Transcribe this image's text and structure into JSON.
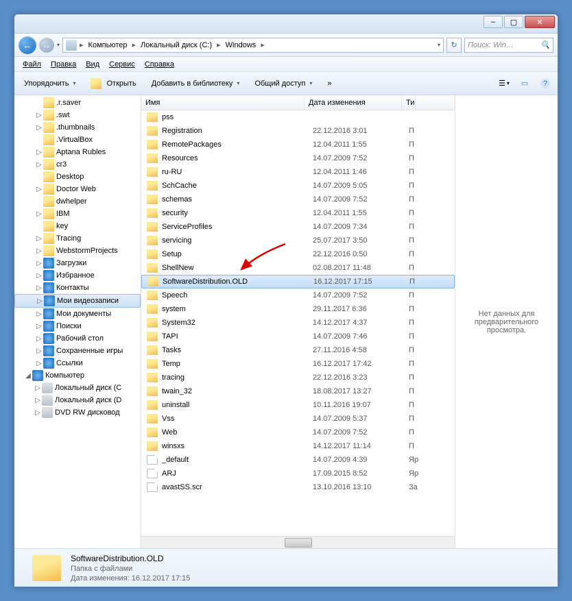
{
  "titlebar": {
    "min": "–",
    "max": "▢",
    "close": "✕"
  },
  "nav": {
    "back_arrow": "←",
    "fwd_arrow": "→",
    "dropdown": "▾",
    "crumbs": [
      "Компьютер",
      "Локальный диск (C:)",
      "Windows"
    ],
    "sep": "▸",
    "refresh_icon": "↻",
    "search_placeholder": "Поиск: Win…",
    "search_icon": "🔍"
  },
  "menu": [
    "Файл",
    "Правка",
    "Вид",
    "Сервис",
    "Справка"
  ],
  "toolbar": {
    "organize": "Упорядочить",
    "open": "Открыть",
    "addlib": "Добавить в библиотеку",
    "share": "Общий доступ",
    "more": "»",
    "view_icon": "☰",
    "preview_icon": "▭",
    "help_icon": "?"
  },
  "tree": [
    {
      "ind": 30,
      "exp": "",
      "icon": "f",
      "label": ".r.saver"
    },
    {
      "ind": 30,
      "exp": "▷",
      "icon": "f",
      "label": ".swt"
    },
    {
      "ind": 30,
      "exp": "▷",
      "icon": "f",
      "label": ".thumbnails"
    },
    {
      "ind": 30,
      "exp": "",
      "icon": "f",
      "label": ".VirtualBox"
    },
    {
      "ind": 30,
      "exp": "▷",
      "icon": "f",
      "label": "Aptana Rubles"
    },
    {
      "ind": 30,
      "exp": "▷",
      "icon": "f",
      "label": "cr3"
    },
    {
      "ind": 30,
      "exp": "",
      "icon": "f",
      "label": "Desktop"
    },
    {
      "ind": 30,
      "exp": "▷",
      "icon": "f",
      "label": "Doctor Web"
    },
    {
      "ind": 30,
      "exp": "",
      "icon": "f",
      "label": "dwhelper"
    },
    {
      "ind": 30,
      "exp": "▷",
      "icon": "f",
      "label": "IBM"
    },
    {
      "ind": 30,
      "exp": "",
      "icon": "f",
      "label": "key"
    },
    {
      "ind": 30,
      "exp": "▷",
      "icon": "f",
      "label": "Tracing"
    },
    {
      "ind": 30,
      "exp": "▷",
      "icon": "f",
      "label": "WebstormProjects"
    },
    {
      "ind": 30,
      "exp": "▷",
      "icon": "sp",
      "label": "Загрузки"
    },
    {
      "ind": 30,
      "exp": "▷",
      "icon": "sp",
      "label": "Избранное"
    },
    {
      "ind": 30,
      "exp": "▷",
      "icon": "sp",
      "label": "Контакты"
    },
    {
      "ind": 30,
      "exp": "▷",
      "icon": "sp",
      "label": "Мои видеозаписи",
      "sel": true
    },
    {
      "ind": 30,
      "exp": "▷",
      "icon": "sp",
      "label": "Мои документы"
    },
    {
      "ind": 30,
      "exp": "▷",
      "icon": "sp",
      "label": "Поиски"
    },
    {
      "ind": 30,
      "exp": "▷",
      "icon": "sp",
      "label": "Рабочий стол"
    },
    {
      "ind": 30,
      "exp": "▷",
      "icon": "sp",
      "label": "Сохраненные игры"
    },
    {
      "ind": 30,
      "exp": "▷",
      "icon": "sp",
      "label": "Ссылки"
    },
    {
      "ind": 14,
      "exp": "◢",
      "icon": "sp",
      "label": "Компьютер"
    },
    {
      "ind": 28,
      "exp": "▷",
      "icon": "disk",
      "label": "Локальный диск (C"
    },
    {
      "ind": 28,
      "exp": "▷",
      "icon": "disk",
      "label": "Локальный диск (D"
    },
    {
      "ind": 28,
      "exp": "▷",
      "icon": "disk",
      "label": "DVD RW дисковод"
    }
  ],
  "cols": {
    "name": "Имя",
    "date": "Дата изменения",
    "type": "Ти"
  },
  "files": [
    {
      "icon": "f",
      "name": "pss",
      "date": "",
      "type": ""
    },
    {
      "icon": "f",
      "name": "Registration",
      "date": "22.12.2016 3:01",
      "type": "П"
    },
    {
      "icon": "f",
      "name": "RemotePackages",
      "date": "12.04.2011 1:55",
      "type": "П"
    },
    {
      "icon": "f",
      "name": "Resources",
      "date": "14.07.2009 7:52",
      "type": "П"
    },
    {
      "icon": "f",
      "name": "ru-RU",
      "date": "12.04.2011 1:46",
      "type": "П"
    },
    {
      "icon": "f",
      "name": "SchCache",
      "date": "14.07.2009 5:05",
      "type": "П"
    },
    {
      "icon": "f",
      "name": "schemas",
      "date": "14.07.2009 7:52",
      "type": "П"
    },
    {
      "icon": "f",
      "name": "security",
      "date": "12.04.2011 1:55",
      "type": "П"
    },
    {
      "icon": "f",
      "name": "ServiceProfiles",
      "date": "14.07.2009 7:34",
      "type": "П"
    },
    {
      "icon": "f",
      "name": "servicing",
      "date": "25.07.2017 3:50",
      "type": "П"
    },
    {
      "icon": "f",
      "name": "Setup",
      "date": "22.12.2016 0:50",
      "type": "П"
    },
    {
      "icon": "f",
      "name": "ShellNew",
      "date": "02.08.2017 11:48",
      "type": "П"
    },
    {
      "icon": "f",
      "name": "SoftwareDistribution.OLD",
      "date": "16.12.2017 17:15",
      "type": "П",
      "sel": true
    },
    {
      "icon": "f",
      "name": "Speech",
      "date": "14.07.2009 7:52",
      "type": "П"
    },
    {
      "icon": "f",
      "name": "system",
      "date": "29.11.2017 6:36",
      "type": "П"
    },
    {
      "icon": "f",
      "name": "System32",
      "date": "14.12.2017 4:37",
      "type": "П"
    },
    {
      "icon": "f",
      "name": "TAPI",
      "date": "14.07.2009 7:46",
      "type": "П"
    },
    {
      "icon": "f",
      "name": "Tasks",
      "date": "27.11.2016 4:58",
      "type": "П"
    },
    {
      "icon": "f",
      "name": "Temp",
      "date": "16.12.2017 17:42",
      "type": "П"
    },
    {
      "icon": "f",
      "name": "tracing",
      "date": "22.12.2016 3:23",
      "type": "П"
    },
    {
      "icon": "f",
      "name": "twain_32",
      "date": "18.08.2017 13:27",
      "type": "П"
    },
    {
      "icon": "f",
      "name": "uninstall",
      "date": "10.11.2016 19:07",
      "type": "П"
    },
    {
      "icon": "f",
      "name": "Vss",
      "date": "14.07.2009 5:37",
      "type": "П"
    },
    {
      "icon": "f",
      "name": "Web",
      "date": "14.07.2009 7:52",
      "type": "П"
    },
    {
      "icon": "f",
      "name": "winsxs",
      "date": "14.12.2017 11:14",
      "type": "П"
    },
    {
      "icon": "file",
      "name": "_default",
      "date": "14.07.2009 4:39",
      "type": "Яр"
    },
    {
      "icon": "file",
      "name": "ARJ",
      "date": "17.09.2015 8:52",
      "type": "Яр"
    },
    {
      "icon": "file",
      "name": "avastSS.scr",
      "date": "13.10.2016 13:10",
      "type": "За"
    }
  ],
  "preview": "Нет данных для предварительного просмотра.",
  "details": {
    "name": "SoftwareDistribution.OLD",
    "type": "Папка с файлами",
    "date_label": "Дата изменения:",
    "date": "16.12.2017 17:15"
  }
}
